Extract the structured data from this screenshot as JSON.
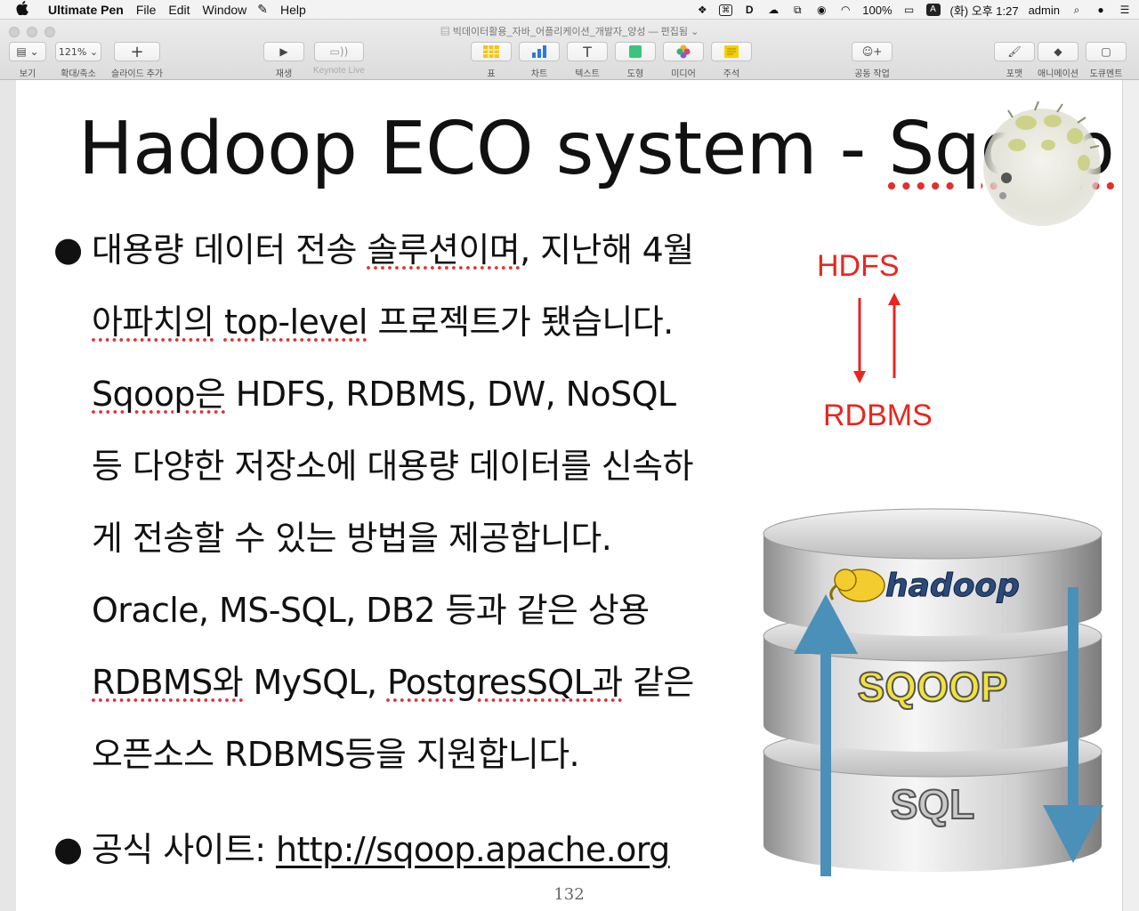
{
  "menubar": {
    "apple": "",
    "app_name": "Ultimate Pen",
    "menus": [
      "File",
      "Edit",
      "Window",
      "Help"
    ],
    "status": {
      "battery": "100%",
      "input": "A",
      "clock": "(화) 오후 1:27",
      "user": "admin"
    }
  },
  "window": {
    "doc_title": "빅데이터활용_자바_어플리케이션_개발자_양성",
    "doc_state": "— 편집됨"
  },
  "toolbar": {
    "view_label": "보기",
    "zoom_value": "121%",
    "zoom_label": "확대/축소",
    "add_slide_label": "슬라이드 추가",
    "play_label": "재생",
    "keynote_live_label": "Keynote Live",
    "table_label": "표",
    "chart_label": "차트",
    "text_label": "텍스트",
    "shape_label": "도형",
    "media_label": "미디어",
    "comment_label": "주석",
    "collab_label": "공동 작업",
    "format_label": "포맷",
    "animate_label": "애니메이션",
    "document_label": "도큐멘트"
  },
  "slide": {
    "title_pre": "Hadoop ECO system - ",
    "title_word": "Sqoop",
    "bullet1": {
      "l1a": "대용량 데이터 전송 ",
      "l1b": "솔루션이며",
      "l1c": ", 지난해 4월",
      "l2a": "아파치의",
      "l2b": " ",
      "l2c": "top-level",
      "l2d": " 프로젝트가 됐습니다.",
      "l3a": "Sqoop은",
      "l3b": " HDFS, RDBMS, DW, NoSQL",
      "l4": "등 다양한 저장소에 대용량 데이터를 신속하",
      "l5": "게 전송할 수 있는 방법을 제공합니다.",
      "l6": "Oracle, MS-SQL, DB2 등과 같은 상용",
      "l7a": "RDBMS와",
      "l7b": " MySQL, ",
      "l7c": "PostgresSQL과",
      "l7d": " 같은",
      "l8": "오픈소스 RDBMS등을 지원합니다."
    },
    "bullet2": {
      "label": "공식 사이트: ",
      "link": "http://sqoop.apache.org"
    },
    "diagram": {
      "top": "HDFS",
      "bottom": "RDBMS"
    },
    "stack": {
      "layer1": "hadoop",
      "layer2": "SQOOP",
      "layer3": "SQL"
    },
    "page_number": "132"
  },
  "colors": {
    "accent_red": "#e8261f",
    "arrow_blue": "#4a90b8",
    "sqoop_yellow": "#f2e23a"
  }
}
